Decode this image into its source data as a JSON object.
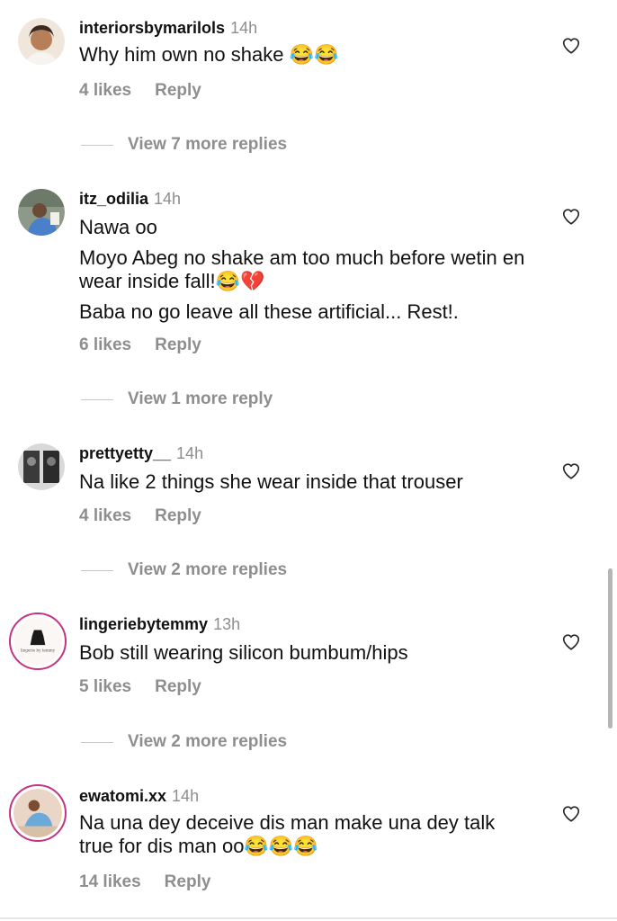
{
  "comments": [
    {
      "username": "interiorsbymarilols",
      "time": "14h",
      "lines": [
        "Why him own no shake 😂😂"
      ],
      "likes": "4 likes",
      "reply": "Reply",
      "view_more": "View 7 more replies"
    },
    {
      "username": "itz_odilia",
      "time": "14h",
      "lines": [
        "Nawa oo",
        "Moyo Abeg no shake am too much before wetin en wear inside fall!😂💔",
        "Baba no go leave all these artificial... Rest!."
      ],
      "likes": "6 likes",
      "reply": "Reply",
      "view_more": "View 1 more reply"
    },
    {
      "username": "prettyetty__",
      "time": "14h",
      "lines": [
        "Na like 2 things she wear inside that trouser"
      ],
      "likes": "4 likes",
      "reply": "Reply",
      "view_more": "View 2 more replies"
    },
    {
      "username": "lingeriebytemmy",
      "time": "13h",
      "lines": [
        "Bob still wearing silicon bumbum/hips"
      ],
      "likes": "5 likes",
      "reply": "Reply",
      "view_more": "View 2 more replies"
    },
    {
      "username": "ewatomi.xx",
      "time": "14h",
      "lines": [
        "Na una dey deceive dis man make una dey talk true for dis man oo😂😂😂"
      ],
      "likes": "14 likes",
      "reply": "Reply"
    }
  ],
  "icons": {
    "like": "heart-outline-icon"
  },
  "colors": {
    "secondary_text": "#8e8e8e",
    "story_ring": "#c13584"
  }
}
